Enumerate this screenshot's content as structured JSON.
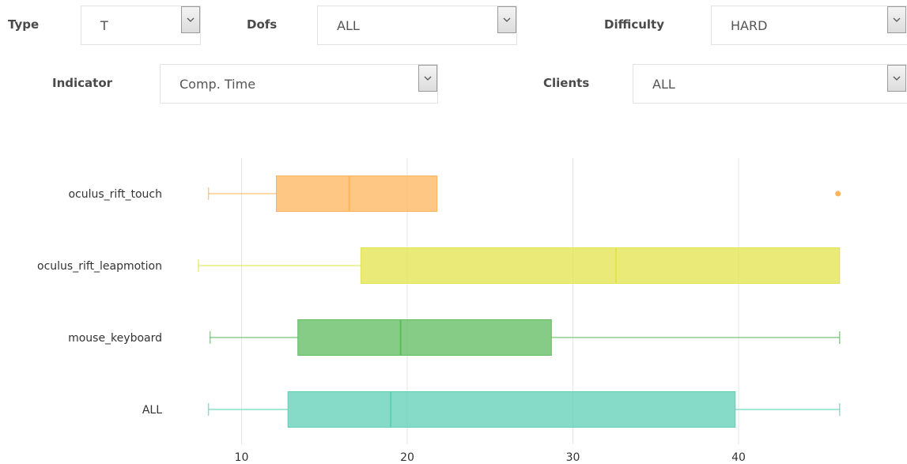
{
  "filters": {
    "type": {
      "label": "Type",
      "value": "T"
    },
    "dofs": {
      "label": "Dofs",
      "value": "ALL"
    },
    "difficulty": {
      "label": "Difficulty",
      "value": "HARD"
    },
    "indicator": {
      "label": "Indicator",
      "value": "Comp. Time"
    },
    "clients": {
      "label": "Clients",
      "value": "ALL"
    }
  },
  "icons": {
    "dropdown": "chevron-down-icon"
  },
  "chart_data": {
    "type": "boxplot",
    "orientation": "horizontal",
    "title": "",
    "xlabel": "",
    "ylabel": "",
    "xlim": [
      7.2,
      46.8
    ],
    "xticks": [
      10,
      20,
      30,
      40
    ],
    "grid": true,
    "categories": [
      "oculus_rift_touch",
      "oculus_rift_leapmotion",
      "mouse_keyboard",
      "ALL"
    ],
    "series": [
      {
        "category": "oculus_rift_touch",
        "whisker_low": 8.0,
        "q1": 12.1,
        "median": 16.5,
        "q3": 21.8,
        "whisker_high": null,
        "outliers": [
          46.0
        ],
        "color": "#fdb55b"
      },
      {
        "category": "oculus_rift_leapmotion",
        "whisker_low": 7.4,
        "q1": 17.2,
        "median": 32.6,
        "q3": 46.1,
        "whisker_high": null,
        "outliers": [],
        "color": "#e3e34c"
      },
      {
        "category": "mouse_keyboard",
        "whisker_low": 8.1,
        "q1": 13.4,
        "median": 19.6,
        "q3": 28.7,
        "whisker_high": 46.1,
        "outliers": [],
        "color": "#5dbb5d"
      },
      {
        "category": "ALL",
        "whisker_low": 8.0,
        "q1": 12.8,
        "median": 19.0,
        "q3": 39.8,
        "whisker_high": 46.1,
        "outliers": [],
        "color": "#5ecfb6"
      }
    ]
  }
}
